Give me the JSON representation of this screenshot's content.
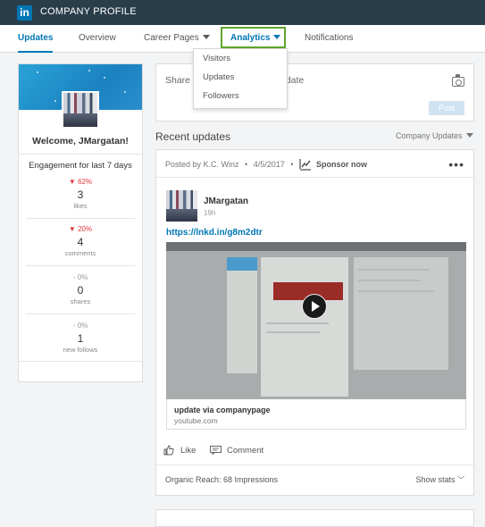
{
  "header": {
    "logo_text": "in",
    "title": "COMPANY PROFILE"
  },
  "tabs": [
    {
      "label": "Updates"
    },
    {
      "label": "Overview"
    },
    {
      "label": "Career Pages"
    },
    {
      "label": "Analytics"
    },
    {
      "label": "Notifications"
    }
  ],
  "analytics_menu": [
    "Visitors",
    "Updates",
    "Followers"
  ],
  "left_panel": {
    "welcome": "Welcome, JMargatan!",
    "engagement_title": "Engagement for last 7 days",
    "stats": [
      {
        "change": "▼ 62%",
        "value": "3",
        "label": "likes"
      },
      {
        "change": "▼ 20%",
        "value": "4",
        "label": "comments"
      },
      {
        "change": "◦ 0%",
        "value": "0",
        "label": "shares"
      },
      {
        "change": "◦ 0%",
        "value": "1",
        "label": "new follows"
      }
    ]
  },
  "share": {
    "placeholder_left": "Share a",
    "placeholder_right": "date",
    "post_label": "Post"
  },
  "feed": {
    "title": "Recent updates",
    "filter_label": "Company Updates"
  },
  "post": {
    "posted_by": "Posted by K.C. Winz",
    "date": "4/5/2017",
    "sponsor_label": "Sponsor now",
    "author": "JMargatan",
    "time_ago": "19h",
    "link": "https://lnkd.in/g8m2dtr",
    "video_title": "update via companypage",
    "video_source": "youtube.com",
    "like_label": "Like",
    "comment_label": "Comment",
    "reach": "Organic Reach: 68 Impressions",
    "show_stats": "Show stats"
  },
  "colors": {
    "header_bg": "#293e4a",
    "accent": "#0077b5",
    "highlight_box": "#5fa72e",
    "decrease": "#e0383c"
  }
}
